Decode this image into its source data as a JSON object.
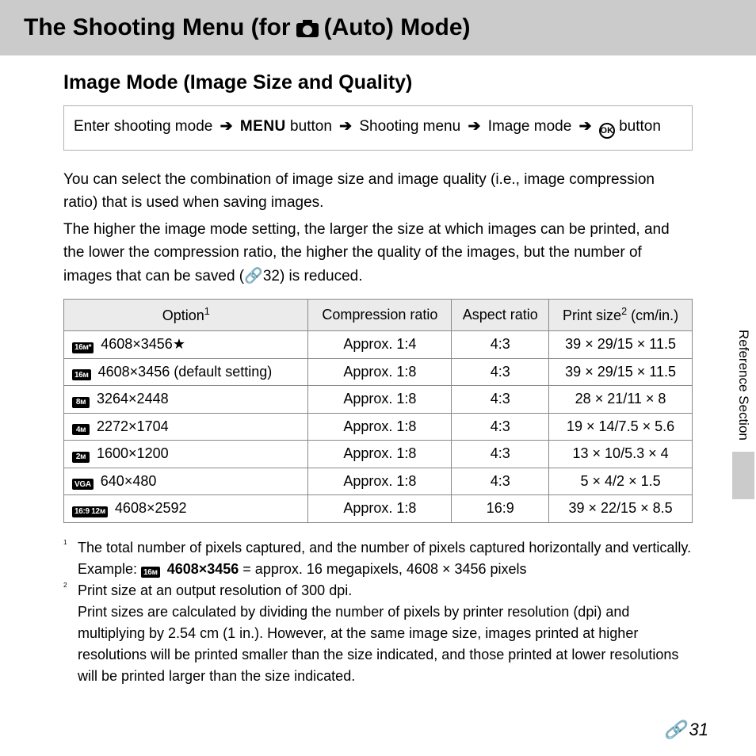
{
  "header": {
    "title_pre": "The Shooting Menu (for ",
    "title_post": " (Auto) Mode)"
  },
  "subtitle": "Image Mode (Image Size and Quality)",
  "breadcrumb": {
    "step1": "Enter shooting mode",
    "menu_label": "MENU",
    "step2_post": " button",
    "step3": "Shooting menu",
    "step4": "Image mode",
    "step5_post": " button"
  },
  "body": {
    "p1": "You can select the combination of image size and image quality (i.e., image compression ratio) that is used when saving images.",
    "p2a": "The higher the image mode setting, the larger the size at which images can be printed, and the lower the compression ratio, the higher the quality of the images, but the number of images that can be saved (",
    "p2_ref": "32",
    "p2b": ") is reduced."
  },
  "table": {
    "headers": {
      "option": "Option",
      "ratio": "Compression ratio",
      "aspect": "Aspect ratio",
      "print": "Print size",
      "print_unit": " (cm/in.)"
    },
    "rows": [
      {
        "badge": "16ᴍ*",
        "label": " 4608×3456★",
        "ratio": "Approx. 1:4",
        "aspect": "4:3",
        "print": "39 × 29/15 × 11.5"
      },
      {
        "badge": "16ᴍ",
        "label": " 4608×3456 (default setting)",
        "ratio": "Approx. 1:8",
        "aspect": "4:3",
        "print": "39 × 29/15 × 11.5"
      },
      {
        "badge": "8ᴍ",
        "label": " 3264×2448",
        "ratio": "Approx. 1:8",
        "aspect": "4:3",
        "print": "28 × 21/11 × 8"
      },
      {
        "badge": "4ᴍ",
        "label": " 2272×1704",
        "ratio": "Approx. 1:8",
        "aspect": "4:3",
        "print": "19 × 14/7.5 × 5.6"
      },
      {
        "badge": "2ᴍ",
        "label": " 1600×1200",
        "ratio": "Approx. 1:8",
        "aspect": "4:3",
        "print": "13 × 10/5.3 × 4"
      },
      {
        "badge": "VGA",
        "label": " 640×480",
        "ratio": "Approx. 1:8",
        "aspect": "4:3",
        "print": "5 × 4/2 × 1.5"
      },
      {
        "badge": "16:9 12ᴍ",
        "label": " 4608×2592",
        "ratio": "Approx. 1:8",
        "aspect": "16:9",
        "print": "39 × 22/15 × 8.5"
      }
    ]
  },
  "footnotes": {
    "fn1a": "The total number of pixels captured, and the number of pixels captured horizontally and vertically.",
    "fn1b_pre": "Example: ",
    "fn1b_bold": "4608×3456",
    "fn1b_post": " = approx. 16 megapixels, 4608 × 3456 pixels",
    "fn2a": "Print size at an output resolution of 300 dpi.",
    "fn2b": "Print sizes are calculated by dividing the number of pixels by printer resolution (dpi) and multiplying by 2.54 cm (1 in.). However, at the same image size, images printed at higher resolutions will be printed smaller than the size indicated, and those printed at lower resolutions will be printed larger than the size indicated."
  },
  "side_label": "Reference Section",
  "page_number": "31"
}
